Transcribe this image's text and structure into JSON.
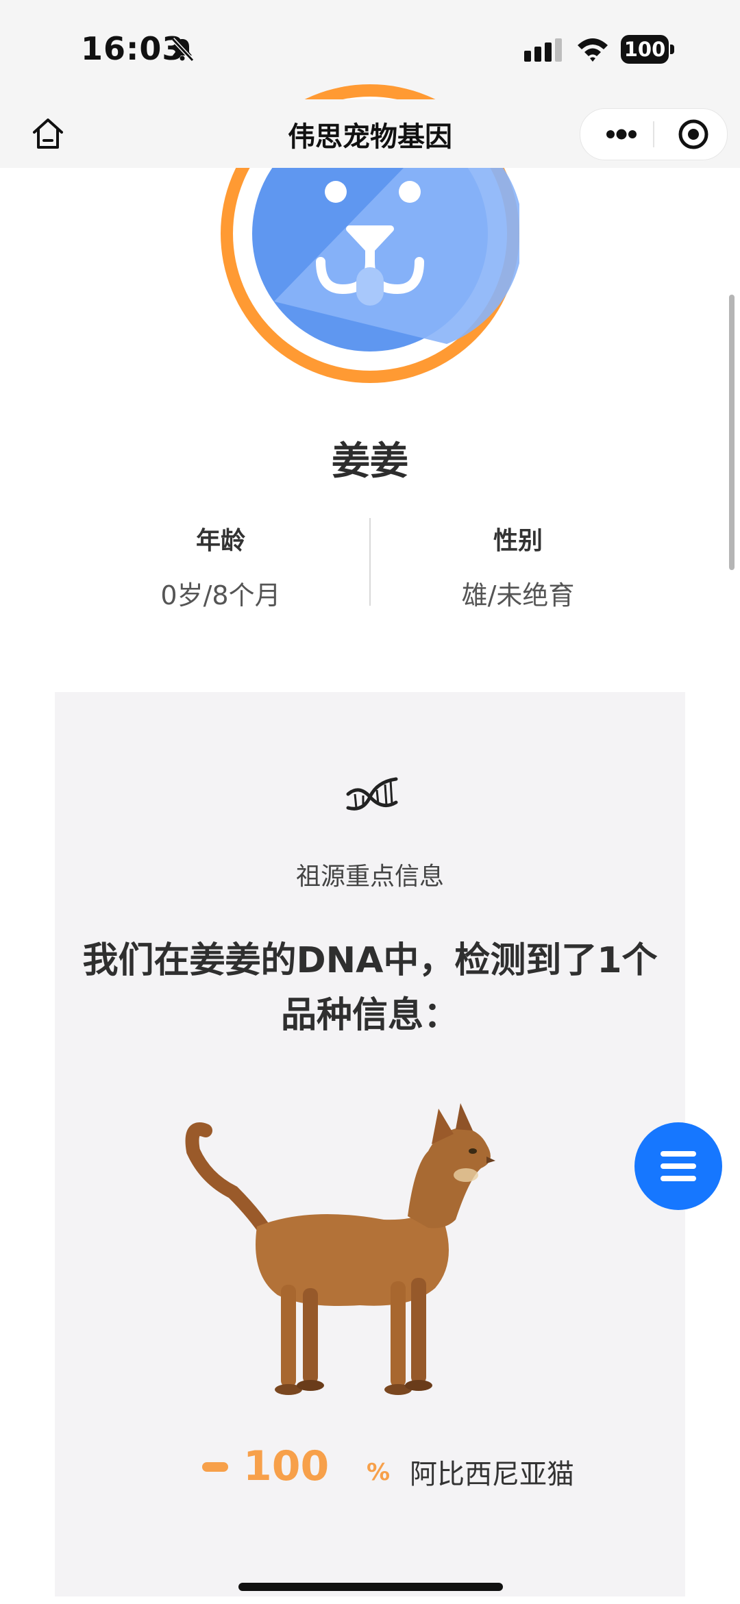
{
  "status_bar": {
    "time": "16:03",
    "battery": "100"
  },
  "nav": {
    "title": "伟思宠物基因"
  },
  "pet": {
    "name": "姜姜",
    "age_label": "年龄",
    "age_value": "0岁/8个月",
    "gender_label": "性别",
    "gender_value": "雄/未绝育"
  },
  "ancestry_card": {
    "subtitle": "祖源重点信息",
    "headline": "我们在姜姜的DNA中，检测到了1个品种信息：",
    "breed": {
      "percent": "100",
      "percent_sign": "%",
      "name": "阿比西尼亚猫"
    }
  },
  "colors": {
    "accent_orange": "#f7a04a",
    "fab_blue": "#1677ff",
    "avatar_blue": "#5f97f0",
    "card_bg": "#f4f3f5"
  },
  "icons": [
    "home-icon",
    "more-dots-icon",
    "close-target-icon",
    "dna-icon",
    "menu-icon",
    "bell-muted-icon",
    "signal-icon",
    "wifi-icon",
    "battery-icon"
  ]
}
